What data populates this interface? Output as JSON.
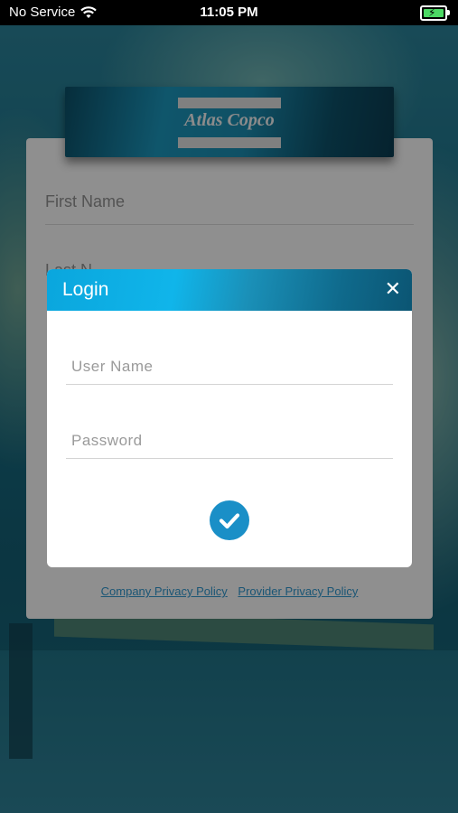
{
  "status_bar": {
    "carrier": "No Service",
    "time": "11:05 PM"
  },
  "logo": {
    "text": "Atlas Copco"
  },
  "form": {
    "first_name_placeholder": "First Name",
    "last_name_placeholder": "Last N",
    "company_policy_link": "Company Privacy Policy",
    "provider_policy_link": "Provider Privacy Policy"
  },
  "login_dialog": {
    "title": "Login",
    "close_icon": "close-icon",
    "username_placeholder": "User Name",
    "password_placeholder": "Password",
    "submit_icon": "checkmark-icon"
  },
  "colors": {
    "accent": "#1a8fc7",
    "header_start": "#0aa6dd",
    "header_end": "#0b5573",
    "link": "#2e8fc4"
  }
}
